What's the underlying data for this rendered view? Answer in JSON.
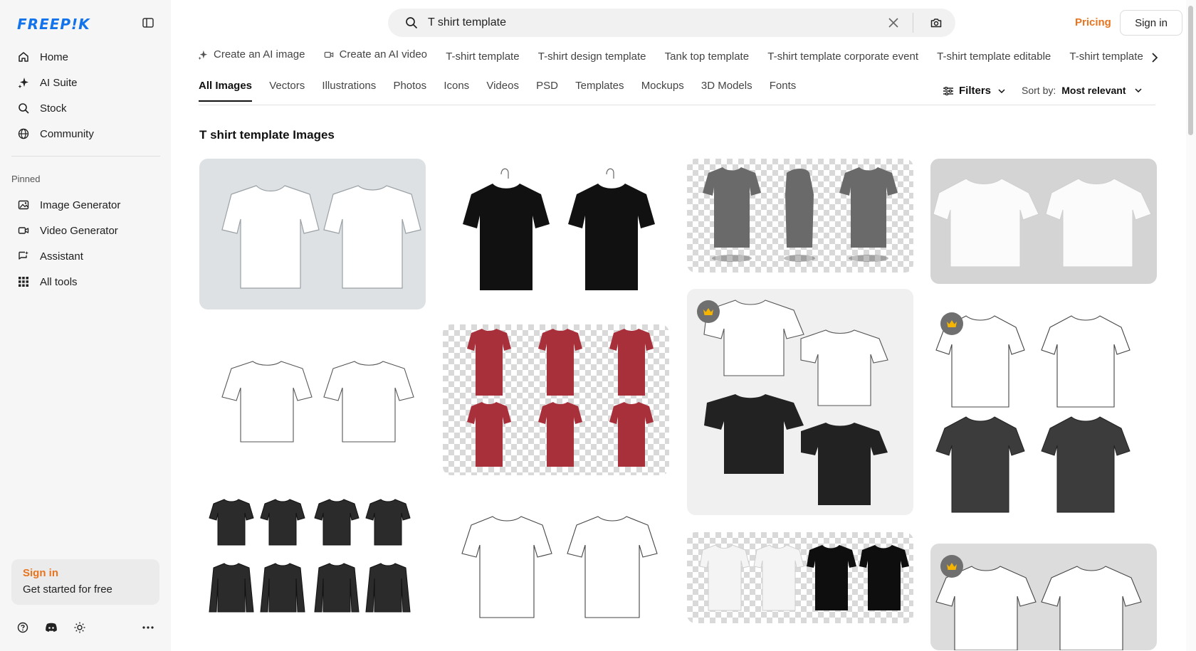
{
  "brand": {
    "logo": "FREEP!K",
    "accent": "#1273eb",
    "orange": "#e8741e"
  },
  "sidebar": {
    "nav": [
      {
        "label": "Home",
        "icon": "home-icon"
      },
      {
        "label": "AI Suite",
        "icon": "sparkle-icon"
      },
      {
        "label": "Stock",
        "icon": "search-icon"
      },
      {
        "label": "Community",
        "icon": "globe-icon"
      }
    ],
    "pinned_label": "Pinned",
    "pinned": [
      {
        "label": "Image Generator",
        "icon": "image-icon"
      },
      {
        "label": "Video Generator",
        "icon": "video-icon"
      },
      {
        "label": "Assistant",
        "icon": "chat-icon"
      },
      {
        "label": "All tools",
        "icon": "grid-icon"
      }
    ],
    "signin_card": {
      "link": "Sign in",
      "text": "Get started for free"
    }
  },
  "header": {
    "search_value": "T shirt template",
    "pricing": "Pricing",
    "signin": "Sign in"
  },
  "suggestions": [
    {
      "label": "Create an AI image",
      "icon": "sparkle-icon"
    },
    {
      "label": "Create an AI video",
      "icon": "video-icon"
    },
    {
      "label": "T-shirt template"
    },
    {
      "label": "T-shirt design template"
    },
    {
      "label": "Tank top template"
    },
    {
      "label": "T-shirt template corporate event"
    },
    {
      "label": "T-shirt template editable"
    },
    {
      "label": "T-shirt template"
    }
  ],
  "tabs": [
    "All Images",
    "Vectors",
    "Illustrations",
    "Photos",
    "Icons",
    "Videos",
    "PSD",
    "Templates",
    "Mockups",
    "3D Models",
    "Fonts"
  ],
  "active_tab": "All Images",
  "filters_label": "Filters",
  "sort": {
    "label": "Sort by:",
    "value": "Most relevant"
  },
  "results_heading": "T shirt template Images"
}
